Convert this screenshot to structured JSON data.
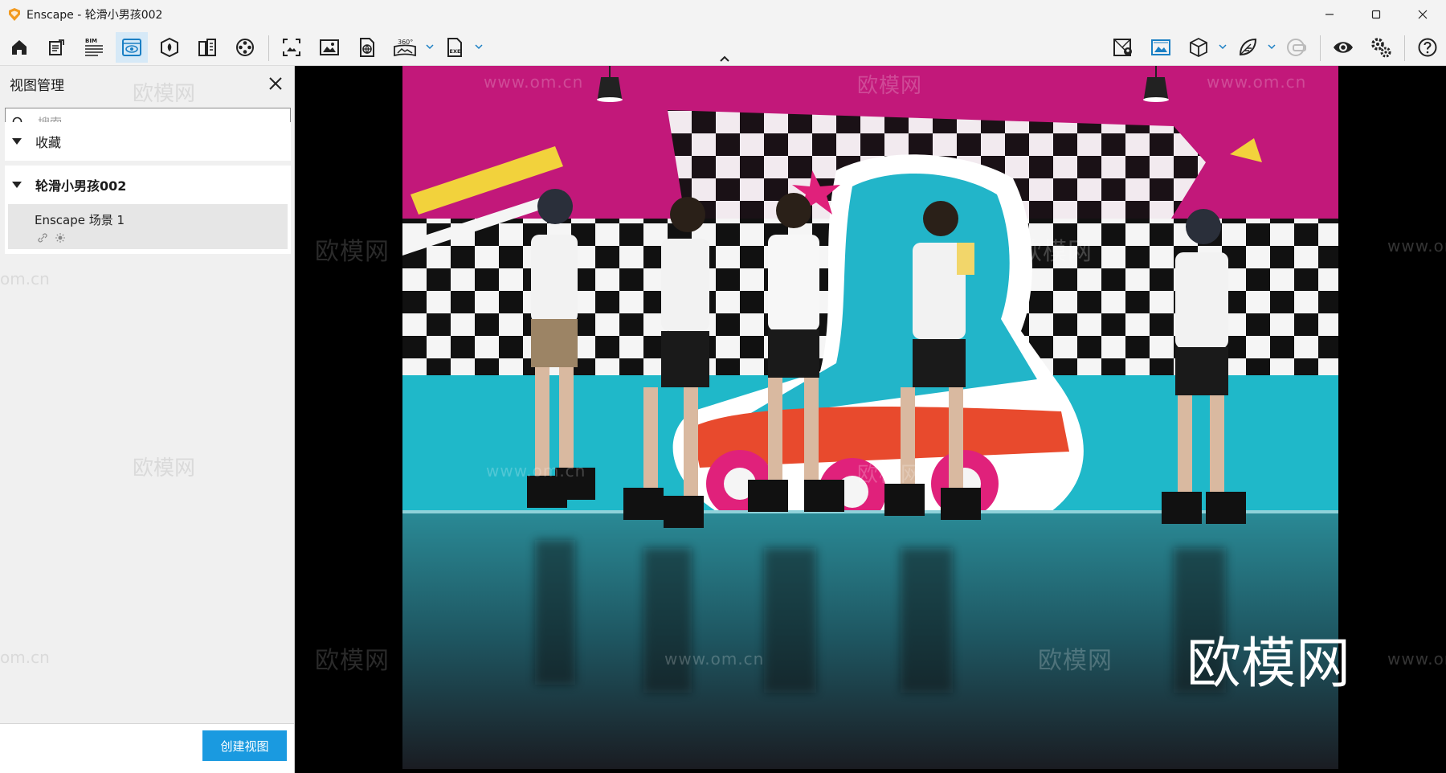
{
  "window": {
    "title": "Enscape - 轮滑小男孩002"
  },
  "toolbar": {
    "bim_label": "BIM",
    "pano_badge": "360°",
    "exe_badge": "EXE"
  },
  "sidebar": {
    "title": "视图管理",
    "search_placeholder": "搜索",
    "favorites_label": "收藏",
    "project_label": "轮滑小男孩002",
    "views": [
      {
        "name": "Enscape 场景 1"
      }
    ],
    "create_view_label": "创建视图"
  },
  "watermarks": {
    "brand_cn": "欧模网",
    "domain": "www.om.cn",
    "domain_short": "om.cn"
  },
  "colors": {
    "accent": "#1a9ae0",
    "active_tab_bg": "#d6e9f7",
    "wall_magenta": "#c2187a",
    "wall_cyan": "#1fb8c9"
  }
}
